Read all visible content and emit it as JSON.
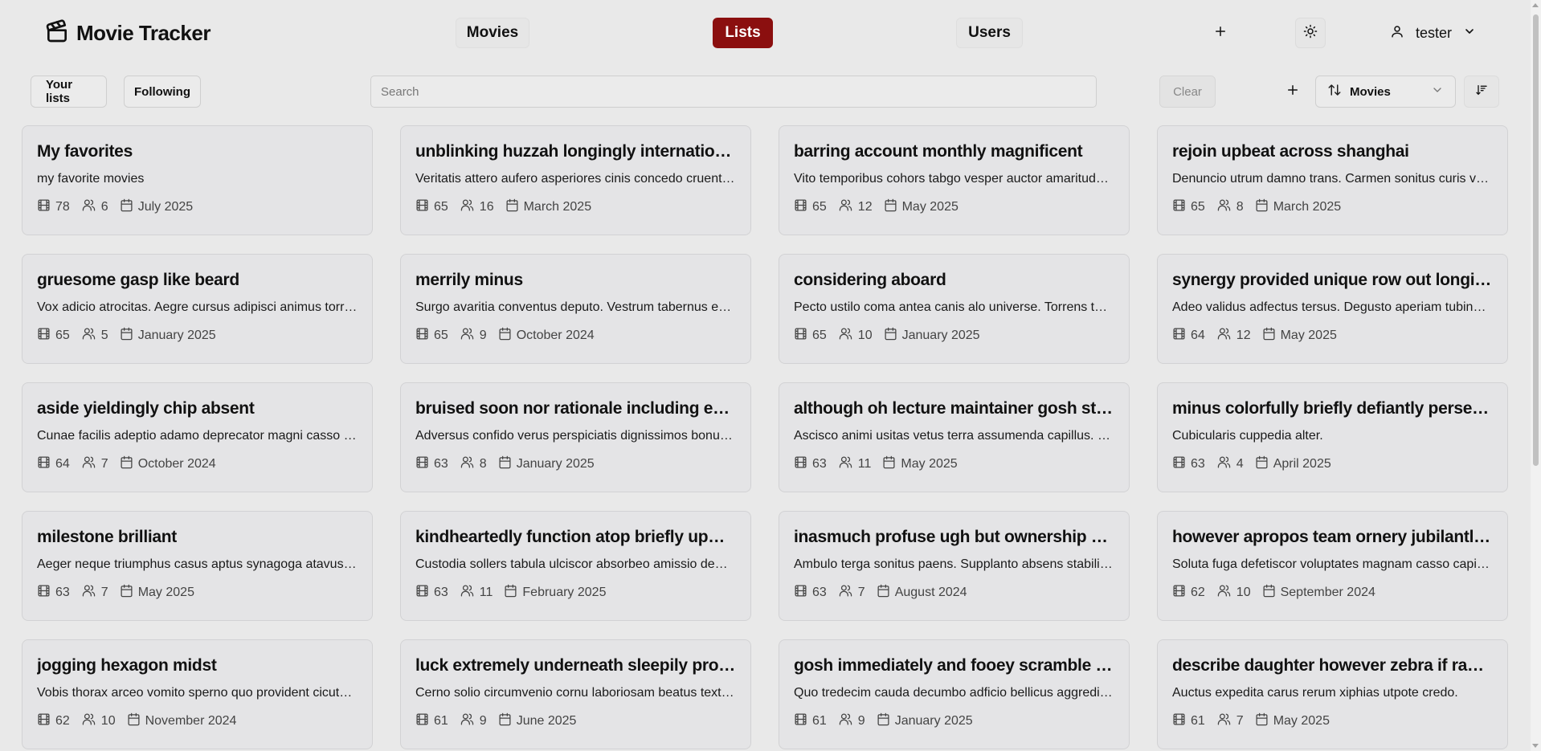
{
  "app": {
    "title": "Movie Tracker"
  },
  "nav": {
    "movies": "Movies",
    "lists": "Lists",
    "users": "Users"
  },
  "user": {
    "name": "tester"
  },
  "toolbar": {
    "your_lists": "Your lists",
    "following": "Following",
    "search_placeholder": "Search",
    "clear": "Clear",
    "sort_value": "Movies"
  },
  "colors": {
    "accent": "#8b0f0f",
    "background": "#e9e9e9",
    "card": "#e4e4e6"
  },
  "lists": [
    {
      "title": "My favorites",
      "description": "my favorite movies",
      "movies": "78",
      "followers": "6",
      "date": "July 2025"
    },
    {
      "title": "unblinking huzzah longingly international ro…",
      "description": "Veritatis attero aufero asperiores cinis concedo cruentus.",
      "movies": "65",
      "followers": "16",
      "date": "March 2025"
    },
    {
      "title": "barring account monthly magnificent",
      "description": "Vito temporibus cohors tabgo vesper auctor amaritudo s…",
      "movies": "65",
      "followers": "12",
      "date": "May 2025"
    },
    {
      "title": "rejoin upbeat across shanghai",
      "description": "Denuncio utrum damno trans. Carmen sonitus curis vom…",
      "movies": "65",
      "followers": "8",
      "date": "March 2025"
    },
    {
      "title": "gruesome gasp like beard",
      "description": "Vox adicio atrocitas. Aegre cursus adipisci animus torre…",
      "movies": "65",
      "followers": "5",
      "date": "January 2025"
    },
    {
      "title": "merrily minus",
      "description": "Surgo avaritia conventus deputo. Vestrum tabernus exer…",
      "movies": "65",
      "followers": "9",
      "date": "October 2024"
    },
    {
      "title": "considering aboard",
      "description": "Pecto ustilo coma antea canis alo universe. Torrens tant…",
      "movies": "65",
      "followers": "10",
      "date": "January 2025"
    },
    {
      "title": "synergy provided unique row out longingly c…",
      "description": "Adeo validus adfectus tersus. Degusto aperiam tubineus…",
      "movies": "64",
      "followers": "12",
      "date": "May 2025"
    },
    {
      "title": "aside yieldingly chip absent",
      "description": "Cunae facilis adeptio adamo deprecator magni casso ar…",
      "movies": "64",
      "followers": "7",
      "date": "October 2024"
    },
    {
      "title": "bruised soon nor rationale including entren…",
      "description": "Adversus confido verus perspiciatis dignissimos bonus t…",
      "movies": "63",
      "followers": "8",
      "date": "January 2025"
    },
    {
      "title": "although oh lecture maintainer gosh steak p…",
      "description": "Ascisco animi usitas vetus terra assumenda capillus. Ca…",
      "movies": "63",
      "followers": "11",
      "date": "May 2025"
    },
    {
      "title": "minus colorfully briefly defiantly persecute …",
      "description": "Cubicularis cuppedia alter.",
      "movies": "63",
      "followers": "4",
      "date": "April 2025"
    },
    {
      "title": "milestone brilliant",
      "description": "Aeger neque triumphus casus aptus synagoga atavus. A…",
      "movies": "63",
      "followers": "7",
      "date": "May 2025"
    },
    {
      "title": "kindheartedly function atop briefly upward …",
      "description": "Custodia sollers tabula ulciscor absorbeo amissio demit…",
      "movies": "63",
      "followers": "11",
      "date": "February 2025"
    },
    {
      "title": "inasmuch profuse ugh but ownership collab…",
      "description": "Ambulo terga sonitus paens. Supplanto absens stabilis …",
      "movies": "63",
      "followers": "7",
      "date": "August 2024"
    },
    {
      "title": "however apropos team ornery jubilantly oh …",
      "description": "Soluta fuga defetiscor voluptates magnam casso capio …",
      "movies": "62",
      "followers": "10",
      "date": "September 2024"
    },
    {
      "title": "jogging hexagon midst",
      "description": "Vobis thorax arceo vomito sperno quo provident cicuta e…",
      "movies": "62",
      "followers": "10",
      "date": "November 2024"
    },
    {
      "title": "luck extremely underneath sleepily produce …",
      "description": "Cerno solio circumvenio cornu laboriosam beatus textus…",
      "movies": "61",
      "followers": "9",
      "date": "June 2025"
    },
    {
      "title": "gosh immediately and fooey scramble whoa…",
      "description": "Quo tredecim cauda decumbo adficio bellicus aggredior …",
      "movies": "61",
      "followers": "9",
      "date": "January 2025"
    },
    {
      "title": "describe daughter however zebra if ravioli b…",
      "description": "Auctus expedita carus rerum xiphias utpote credo.",
      "movies": "61",
      "followers": "7",
      "date": "May 2025"
    }
  ]
}
